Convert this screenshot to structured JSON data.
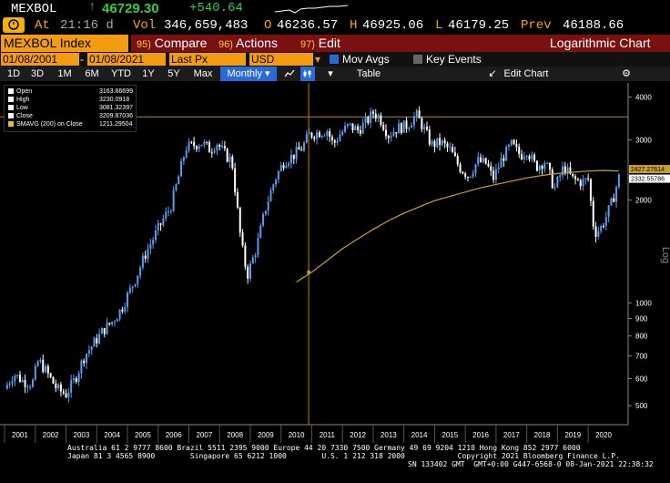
{
  "quote": {
    "ticker": "MEXBOL",
    "arrow": "↑",
    "last": "46729.30",
    "change": "+540.64",
    "at_label": "At",
    "time": "21:16 d",
    "vol_label": "Vol",
    "vol": "346,659,483",
    "open_label": "O",
    "open": "46236.57",
    "high_label": "H",
    "high": "46925.06",
    "low_label": "L",
    "low": "46179.25",
    "prev_label": "Prev",
    "prev": "46188.66"
  },
  "toolbar": {
    "security": "MEXBOL Index",
    "compare_num": "95)",
    "compare": "Compare",
    "actions_num": "96)",
    "actions": "Actions",
    "edit_num": "97)",
    "edit": "Edit",
    "chart_type": "Logarithmic Chart"
  },
  "settings": {
    "start_date": "01/08/2001",
    "end_date": "01/08/2021",
    "field": "Last Px",
    "currency": "USD",
    "mov_avgs": "Mov Avgs",
    "key_events": "Key Events"
  },
  "periods": {
    "items": [
      "1D",
      "3D",
      "1M",
      "6M",
      "YTD",
      "1Y",
      "5Y",
      "Max"
    ],
    "active": "Monthly",
    "table": "Table",
    "edit_chart": "Edit Chart"
  },
  "legend": {
    "open_label": "Open",
    "open": "3163.66699",
    "high_label": "High",
    "high": "3230.0918",
    "low_label": "Low",
    "low": "3081.32397",
    "close_label": "Close",
    "close": "3209.87036",
    "smavg_label": "SMAVG (200)  on Close",
    "smavg": "1211.29504"
  },
  "chart_data": {
    "type": "line",
    "scale": "log",
    "axis_label": "Log",
    "yticks": [
      500,
      600,
      700,
      800,
      900,
      1000,
      2000,
      3000,
      4000
    ],
    "xticks": [
      "2001",
      "2002",
      "2003",
      "2004",
      "2005",
      "2006",
      "2007",
      "2008",
      "2009",
      "2010",
      "2011",
      "2012",
      "2013",
      "2014",
      "2015",
      "2016",
      "2017",
      "2018",
      "2019",
      "2020"
    ],
    "ylim": [
      440,
      4400
    ],
    "last_label": "2332.55786",
    "ma_label": "2427.27614",
    "series": [
      {
        "values": [
          [
            2001.0,
            560
          ],
          [
            2001.3,
            620
          ],
          [
            2001.6,
            590
          ],
          [
            2001.9,
            580
          ],
          [
            2002.1,
            680
          ],
          [
            2002.4,
            620
          ],
          [
            2002.7,
            560
          ],
          [
            2003.0,
            540
          ],
          [
            2003.3,
            600
          ],
          [
            2003.6,
            700
          ],
          [
            2003.9,
            760
          ],
          [
            2004.2,
            830
          ],
          [
            2004.5,
            880
          ],
          [
            2004.8,
            960
          ],
          [
            2005.0,
            1050
          ],
          [
            2005.3,
            1200
          ],
          [
            2005.6,
            1400
          ],
          [
            2005.9,
            1580
          ],
          [
            2006.2,
            1780
          ],
          [
            2006.4,
            1900
          ],
          [
            2006.7,
            2400
          ],
          [
            2006.9,
            2850
          ],
          [
            2007.2,
            2900
          ],
          [
            2007.4,
            2950
          ],
          [
            2007.7,
            2800
          ],
          [
            2007.9,
            2950
          ],
          [
            2008.2,
            2700
          ],
          [
            2008.4,
            2600
          ],
          [
            2008.7,
            1500
          ],
          [
            2008.9,
            1200
          ],
          [
            2009.2,
            1450
          ],
          [
            2009.5,
            1900
          ],
          [
            2009.8,
            2300
          ],
          [
            2010.1,
            2600
          ],
          [
            2010.4,
            2700
          ],
          [
            2010.7,
            2850
          ],
          [
            2010.9,
            3100
          ],
          [
            2011.2,
            3150
          ],
          [
            2011.5,
            3200
          ],
          [
            2011.7,
            2900
          ],
          [
            2011.9,
            3100
          ],
          [
            2012.2,
            3300
          ],
          [
            2012.5,
            3200
          ],
          [
            2012.8,
            3400
          ],
          [
            2013.0,
            3600
          ],
          [
            2013.2,
            3500
          ],
          [
            2013.5,
            3100
          ],
          [
            2013.8,
            3250
          ],
          [
            2014.1,
            3300
          ],
          [
            2014.4,
            3550
          ],
          [
            2014.6,
            3300
          ],
          [
            2014.9,
            2900
          ],
          [
            2015.2,
            2950
          ],
          [
            2015.5,
            2800
          ],
          [
            2015.8,
            2500
          ],
          [
            2016.1,
            2350
          ],
          [
            2016.4,
            2600
          ],
          [
            2016.7,
            2550
          ],
          [
            2016.9,
            2300
          ],
          [
            2017.2,
            2650
          ],
          [
            2017.5,
            2900
          ],
          [
            2017.8,
            2700
          ],
          [
            2018.0,
            2800
          ],
          [
            2018.3,
            2500
          ],
          [
            2018.6,
            2600
          ],
          [
            2018.9,
            2150
          ],
          [
            2019.2,
            2500
          ],
          [
            2019.5,
            2300
          ],
          [
            2019.8,
            2250
          ],
          [
            2020.0,
            2300
          ],
          [
            2020.2,
            1600
          ],
          [
            2020.4,
            1650
          ],
          [
            2020.6,
            1800
          ],
          [
            2020.8,
            2000
          ],
          [
            2021.0,
            2330
          ]
        ]
      },
      {
        "values": [
          [
            2010.5,
            1150
          ],
          [
            2011.0,
            1230
          ],
          [
            2011.5,
            1330
          ],
          [
            2012.0,
            1440
          ],
          [
            2012.5,
            1540
          ],
          [
            2013.0,
            1640
          ],
          [
            2013.5,
            1740
          ],
          [
            2014.0,
            1830
          ],
          [
            2014.5,
            1910
          ],
          [
            2015.0,
            1990
          ],
          [
            2015.5,
            2050
          ],
          [
            2016.0,
            2110
          ],
          [
            2016.5,
            2170
          ],
          [
            2017.0,
            2220
          ],
          [
            2017.5,
            2270
          ],
          [
            2018.0,
            2320
          ],
          [
            2018.5,
            2360
          ],
          [
            2019.0,
            2390
          ],
          [
            2019.5,
            2410
          ],
          [
            2020.0,
            2430
          ],
          [
            2020.5,
            2440
          ],
          [
            2021.0,
            2430
          ]
        ]
      }
    ],
    "crosshair": {
      "x": 2010.9,
      "y": 3500
    }
  },
  "footer": {
    "line1": "Australia 61 2 9777 8600 Brazil 5511 2395 9000 Europe 44 20 7330 7500 Germany 49 69 9204 1210 Hong Kong 852 2977 6000",
    "line2": "Japan 81 3 4565 8900        Singapore 65 6212 1000        U.S. 1 212 318 2000            Copyright 2021 Bloomberg Finance L.P.",
    "line3": "SN 133402 GMT  GMT+0:00 G447-6568-0 08-Jan-2021 22:38:32"
  },
  "colors": {
    "up": "#5a9cf0",
    "down": "#ffffff",
    "ma": "#c8a030",
    "accent": "#f39c12"
  }
}
